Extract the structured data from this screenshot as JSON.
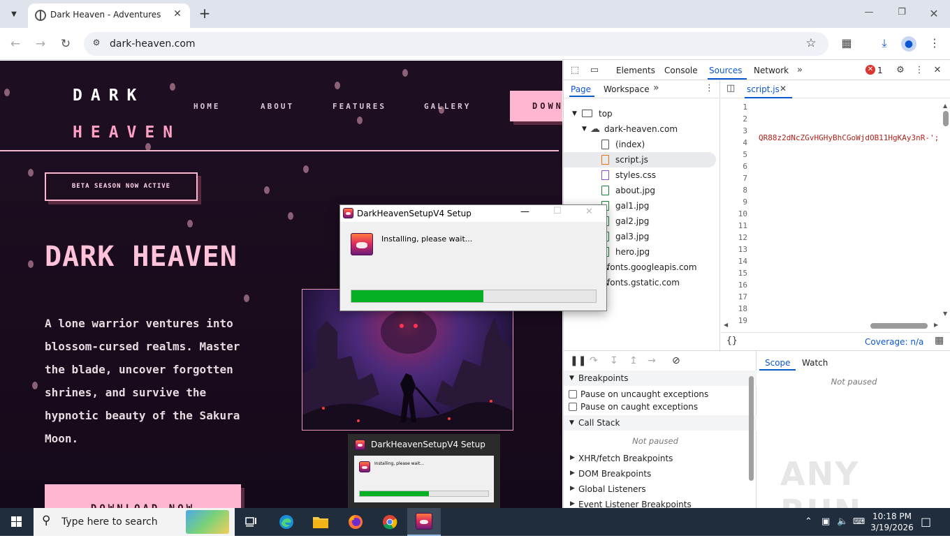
{
  "browser": {
    "tab_title": "Dark Heaven - Adventures of a",
    "url": "dark-heaven.com"
  },
  "site": {
    "logo_line1": "DARK",
    "logo_line2": "HEAVEN",
    "nav": [
      "HOME",
      "ABOUT",
      "FEATURES",
      "GALLERY"
    ],
    "nav_download": "DOWN",
    "beta_badge": "BETA SEASON NOW ACTIVE",
    "hero_title": "DARK HEAVEN",
    "hero_description": "A lone warrior ventures into blossom-cursed realms. Master the blade, uncover forgotten shrines, and survive the hypnotic beauty of the Sakura Moon.",
    "hero_download": "DOWNLOAD NOW"
  },
  "devtools": {
    "tabs": [
      "Elements",
      "Console",
      "Sources",
      "Network"
    ],
    "active_tab": "Sources",
    "error_count": "1",
    "nav_subtabs": [
      "Page",
      "Workspace"
    ],
    "tree": [
      {
        "label": "top",
        "kind": "frame",
        "indent": 0
      },
      {
        "label": "dark-heaven.com",
        "kind": "cloud",
        "indent": 1
      },
      {
        "label": "(index)",
        "kind": "doc",
        "indent": 2
      },
      {
        "label": "script.js",
        "kind": "js",
        "indent": 2
      },
      {
        "label": "styles.css",
        "kind": "css",
        "indent": 2
      },
      {
        "label": "about.jpg",
        "kind": "img",
        "indent": 2
      },
      {
        "label": "gal1.jpg",
        "kind": "img",
        "indent": 2
      },
      {
        "label": "gal2.jpg",
        "kind": "img",
        "indent": 2
      },
      {
        "label": "gal3.jpg",
        "kind": "img",
        "indent": 2
      },
      {
        "label": "hero.jpg",
        "kind": "img",
        "indent": 2
      },
      {
        "label": "fonts.googleapis.com",
        "kind": "cloud",
        "indent": 1
      },
      {
        "label": "fonts.gstatic.com",
        "kind": "cloud",
        "indent": 1
      }
    ],
    "selected_file": "script.js",
    "editor_tab": "script.js",
    "line_numbers": [
      "1",
      "2",
      "3",
      "4",
      "5",
      "6",
      "7",
      "8",
      "9",
      "10",
      "11",
      "12",
      "13",
      "14",
      "15",
      "16",
      "17",
      "18",
      "19"
    ],
    "code_line2": "QR88z2dNcZGvHGHyBhCGoWjdOB11HgKAy3nR-';",
    "coverage": "Coverage: n/a",
    "debug": {
      "breakpoints_label": "Breakpoints",
      "pause_uncaught": "Pause on uncaught exceptions",
      "pause_caught": "Pause on caught exceptions",
      "call_stack_label": "Call Stack",
      "not_paused": "Not paused",
      "sections": [
        "XHR/fetch Breakpoints",
        "DOM Breakpoints",
        "Global Listeners",
        "Event Listener Breakpoints"
      ],
      "scope_tab": "Scope",
      "watch_tab": "Watch",
      "scope_not_paused": "Not paused"
    }
  },
  "installer": {
    "title": "DarkHeavenSetupV4 Setup",
    "message": "Installing, please wait...",
    "progress_percent": 54
  },
  "thumbnail": {
    "title": "DarkHeavenSetupV4 Setup",
    "message": "Installing, please wait...",
    "progress_percent": 54
  },
  "taskbar": {
    "search_placeholder": "Type here to search",
    "time": "10:18 PM",
    "date": "3/19/2026"
  },
  "watermark": "ANY RUN",
  "colors": {
    "accent_pink": "#ffb6d1",
    "progress_green": "#06b025",
    "devtools_blue": "#0b57d0"
  }
}
